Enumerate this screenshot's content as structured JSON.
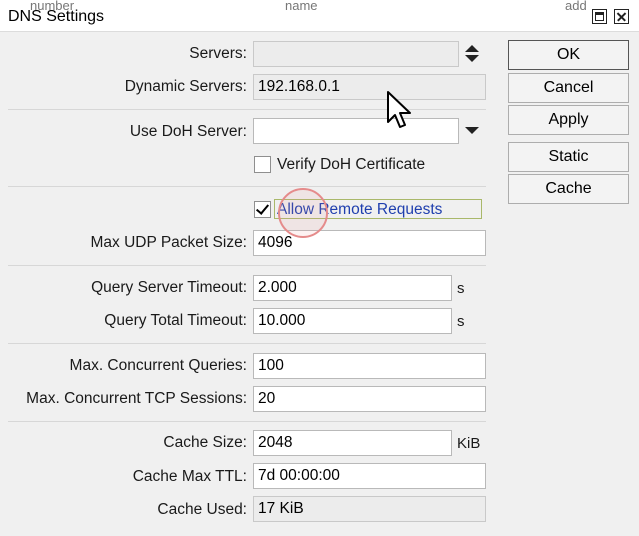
{
  "window": {
    "title": "DNS Settings",
    "strip": [
      "number",
      "name",
      "add"
    ]
  },
  "colors": {
    "link_text": "#1f3fae",
    "highlight_ring": "#e58b8b"
  },
  "fields": {
    "servers": {
      "label": "Servers:",
      "value": ""
    },
    "dynamic_servers": {
      "label": "Dynamic Servers:",
      "value": "192.168.0.1"
    },
    "use_doh_server": {
      "label": "Use DoH Server:",
      "value": ""
    },
    "verify_doh": {
      "label": "Verify DoH Certificate",
      "checked": false
    },
    "allow_remote": {
      "label": "Allow Remote Requests",
      "checked": true
    },
    "max_udp": {
      "label": "Max UDP Packet Size:",
      "value": "4096"
    },
    "query_server_timeout": {
      "label": "Query Server Timeout:",
      "value": "2.000",
      "unit": "s"
    },
    "query_total_timeout": {
      "label": "Query Total Timeout:",
      "value": "10.000",
      "unit": "s"
    },
    "max_concurrent_queries": {
      "label": "Max. Concurrent Queries:",
      "value": "100"
    },
    "max_concurrent_tcp": {
      "label": "Max. Concurrent TCP Sessions:",
      "value": "20"
    },
    "cache_size": {
      "label": "Cache Size:",
      "value": "2048",
      "unit": "KiB"
    },
    "cache_max_ttl": {
      "label": "Cache Max TTL:",
      "value": "7d 00:00:00"
    },
    "cache_used": {
      "label": "Cache Used:",
      "value": "17 KiB"
    }
  },
  "buttons": {
    "ok": "OK",
    "cancel": "Cancel",
    "apply": "Apply",
    "static": "Static",
    "cache": "Cache"
  }
}
